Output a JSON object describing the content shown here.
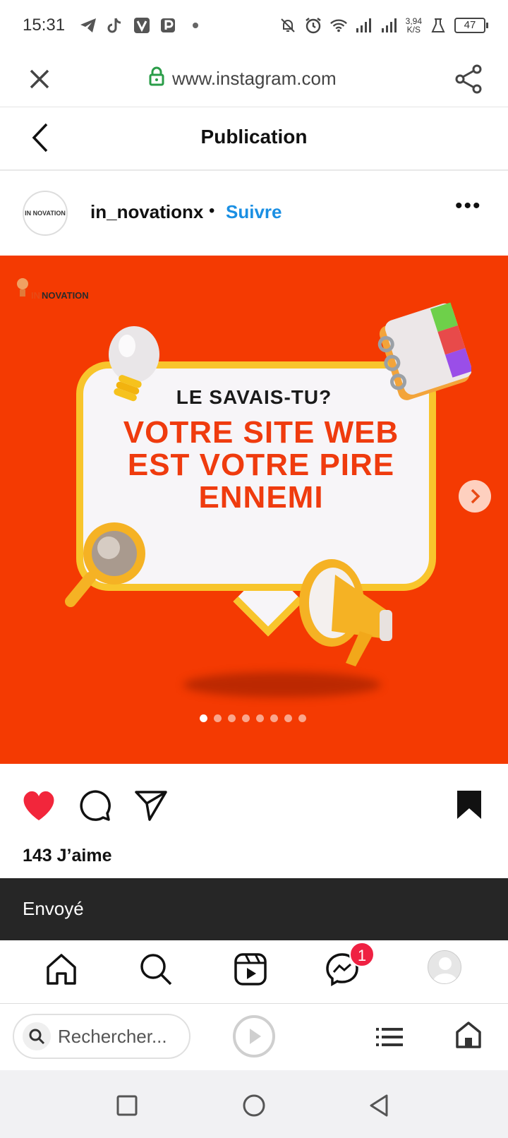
{
  "status_bar": {
    "time": "15:31",
    "network_speed_top": "3,94",
    "network_speed_unit": "K/S",
    "battery": "47",
    "left_icons": [
      "telegram-icon",
      "tiktok-icon",
      "v-app-icon",
      "p-app-icon",
      "dot-icon"
    ],
    "right_icons": [
      "bell-off-icon",
      "alarm-icon",
      "wifi-icon",
      "signal-icon",
      "signal-icon",
      "lab-icon",
      "battery-icon"
    ]
  },
  "url_bar": {
    "url": "www.instagram.com"
  },
  "page_header": {
    "title": "Publication"
  },
  "post": {
    "username": "in_novationx",
    "separator": "•",
    "follow_label": "Suivre",
    "more_label": "•••",
    "avatar_text": "IN NOVATION",
    "image": {
      "brand_prefix": "IN",
      "brand_suffix": "NOVATION",
      "kicker": "LE SAVAIS-TU?",
      "headline": "VOTRE SITE WEB EST VOTRE PIRE ENNEMI",
      "background_color": "#f43a02",
      "accent_color": "#f8c52c",
      "headline_color": "#ef3b0e"
    },
    "carousel": {
      "total": 8,
      "active": 1
    },
    "likes": "143 J’aime",
    "liked": true,
    "saved": true
  },
  "toast": {
    "message": "Envoyé"
  },
  "ig_nav": {
    "items": [
      "home-icon",
      "search-icon",
      "reels-icon",
      "messenger-icon",
      "profile-avatar"
    ],
    "messenger_badge": "1"
  },
  "browser_bar": {
    "search_placeholder": "Rechercher..."
  }
}
